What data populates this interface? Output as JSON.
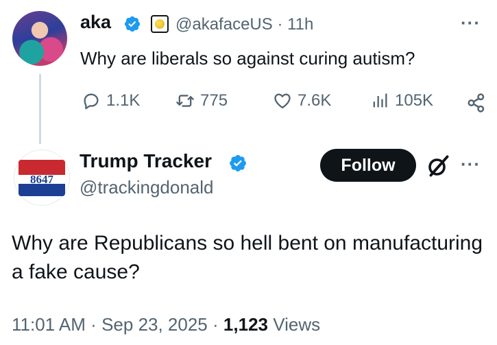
{
  "parent_tweet": {
    "display_name": "aka",
    "handle": "@akafaceUS",
    "time": "11h",
    "separator": "·",
    "text": "Why are liberals so against curing autism?",
    "more": "···",
    "actions": {
      "replies": "1.1K",
      "reposts": "775",
      "likes": "7.6K",
      "views": "105K"
    }
  },
  "main_tweet": {
    "display_name": "Trump Tracker",
    "handle": "@trackingdonald",
    "avatar_text": "8647",
    "follow_label": "Follow",
    "more": "···",
    "text": "Why are Republicans so hell bent on manufacturing a fake cause?",
    "time": "11:01 AM",
    "date": "Sep 23, 2025",
    "views_count": "1,123",
    "views_label": "Views",
    "separator": "·"
  },
  "colors": {
    "text": "#0f1419",
    "muted": "#536471",
    "verified": "#1d9bf0",
    "thread_line": "#cfd9de"
  },
  "icons": [
    "verified-badge-icon",
    "affiliate-badge-icon",
    "reply-icon",
    "repost-icon",
    "like-icon",
    "views-icon",
    "share-icon",
    "grok-icon",
    "more-icon"
  ]
}
